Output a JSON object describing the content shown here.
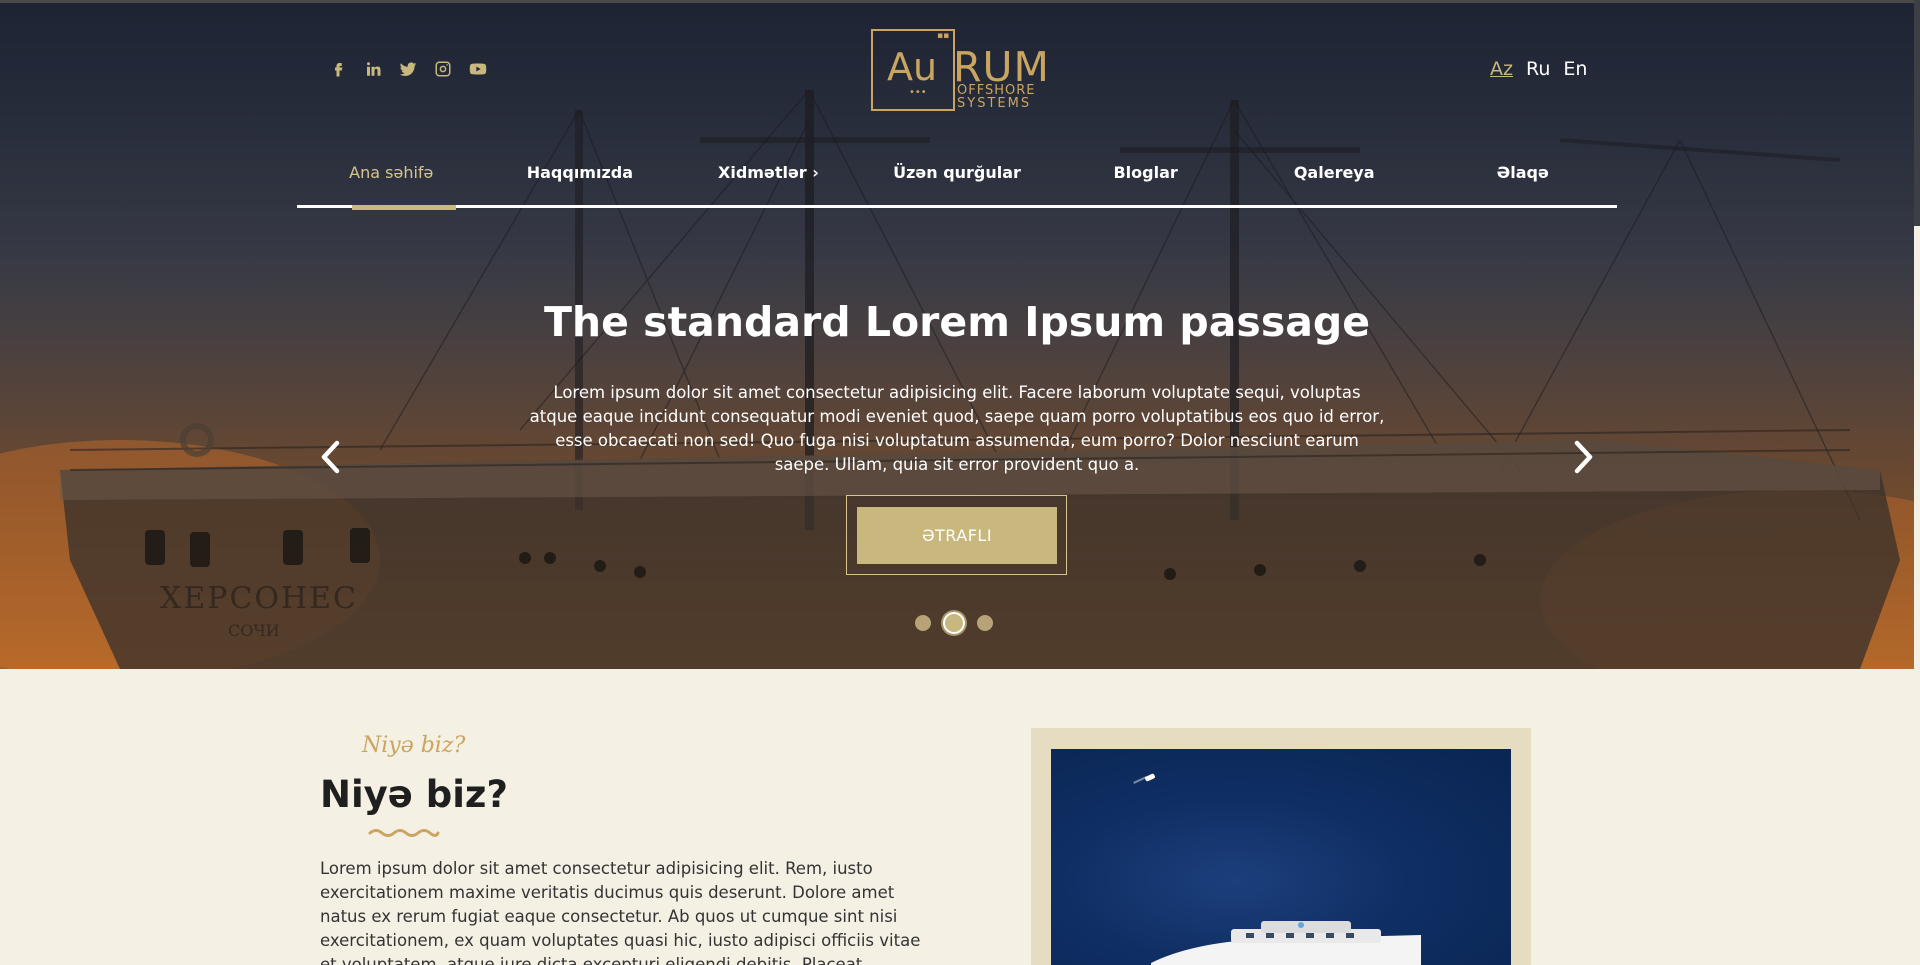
{
  "social": {
    "items": [
      {
        "name": "facebook-icon"
      },
      {
        "name": "linkedin-icon"
      },
      {
        "name": "twitter-icon"
      },
      {
        "name": "instagram-icon"
      },
      {
        "name": "youtube-icon"
      }
    ]
  },
  "logo": {
    "au": "Au",
    "rum": "RUM",
    "line1": "OFFSHORE",
    "line2": "SYSTEMS"
  },
  "languages": {
    "az": "Az",
    "ru": "Ru",
    "en": "En",
    "active": "Az"
  },
  "nav": {
    "items": [
      {
        "label": "Ana səhifə",
        "active": true
      },
      {
        "label": "Haqqımızda"
      },
      {
        "label": "Xidmətlər ›"
      },
      {
        "label": "Üzən qurğular"
      },
      {
        "label": "Bloglar"
      },
      {
        "label": "Qalereya"
      },
      {
        "label": "Əlaqə"
      }
    ]
  },
  "hero": {
    "title": "The standard Lorem Ipsum passage",
    "text": "Lorem ipsum dolor sit amet consectetur adipisicing elit. Facere laborum voluptate sequi, voluptas atque eaque incidunt consequatur modi eveniet quod, saepe quam porro voluptatibus eos quo id error, esse obcaecati non sed! Quo fuga nisi voluptatum assumenda, eum porro? Dolor nesciunt earum saepe. Ullam, quia sit error provident quo a.",
    "button": "ƏTRAFLI",
    "slides": 3,
    "active_slide": 2
  },
  "why": {
    "script_title": "Niyə biz?",
    "title": "Niyə biz?",
    "text": "Lorem ipsum dolor sit amet consectetur adipisicing elit. Rem, iusto exercitationem maxime veritatis ducimus quis deserunt. Dolore amet natus ex rerum fugiat eaque consectetur. Ab quos ut cumque sint nisi exercitationem, ex quam voluptates quasi hic, iusto adipisci officiis vitae et voluptatem, atque iure dicta excepturi eligendi debitis. Placeat accusantium"
  },
  "colors": {
    "accent": "#c9b87e",
    "page_bg": "#f5f0e4",
    "nav_text": "#ffffff"
  }
}
